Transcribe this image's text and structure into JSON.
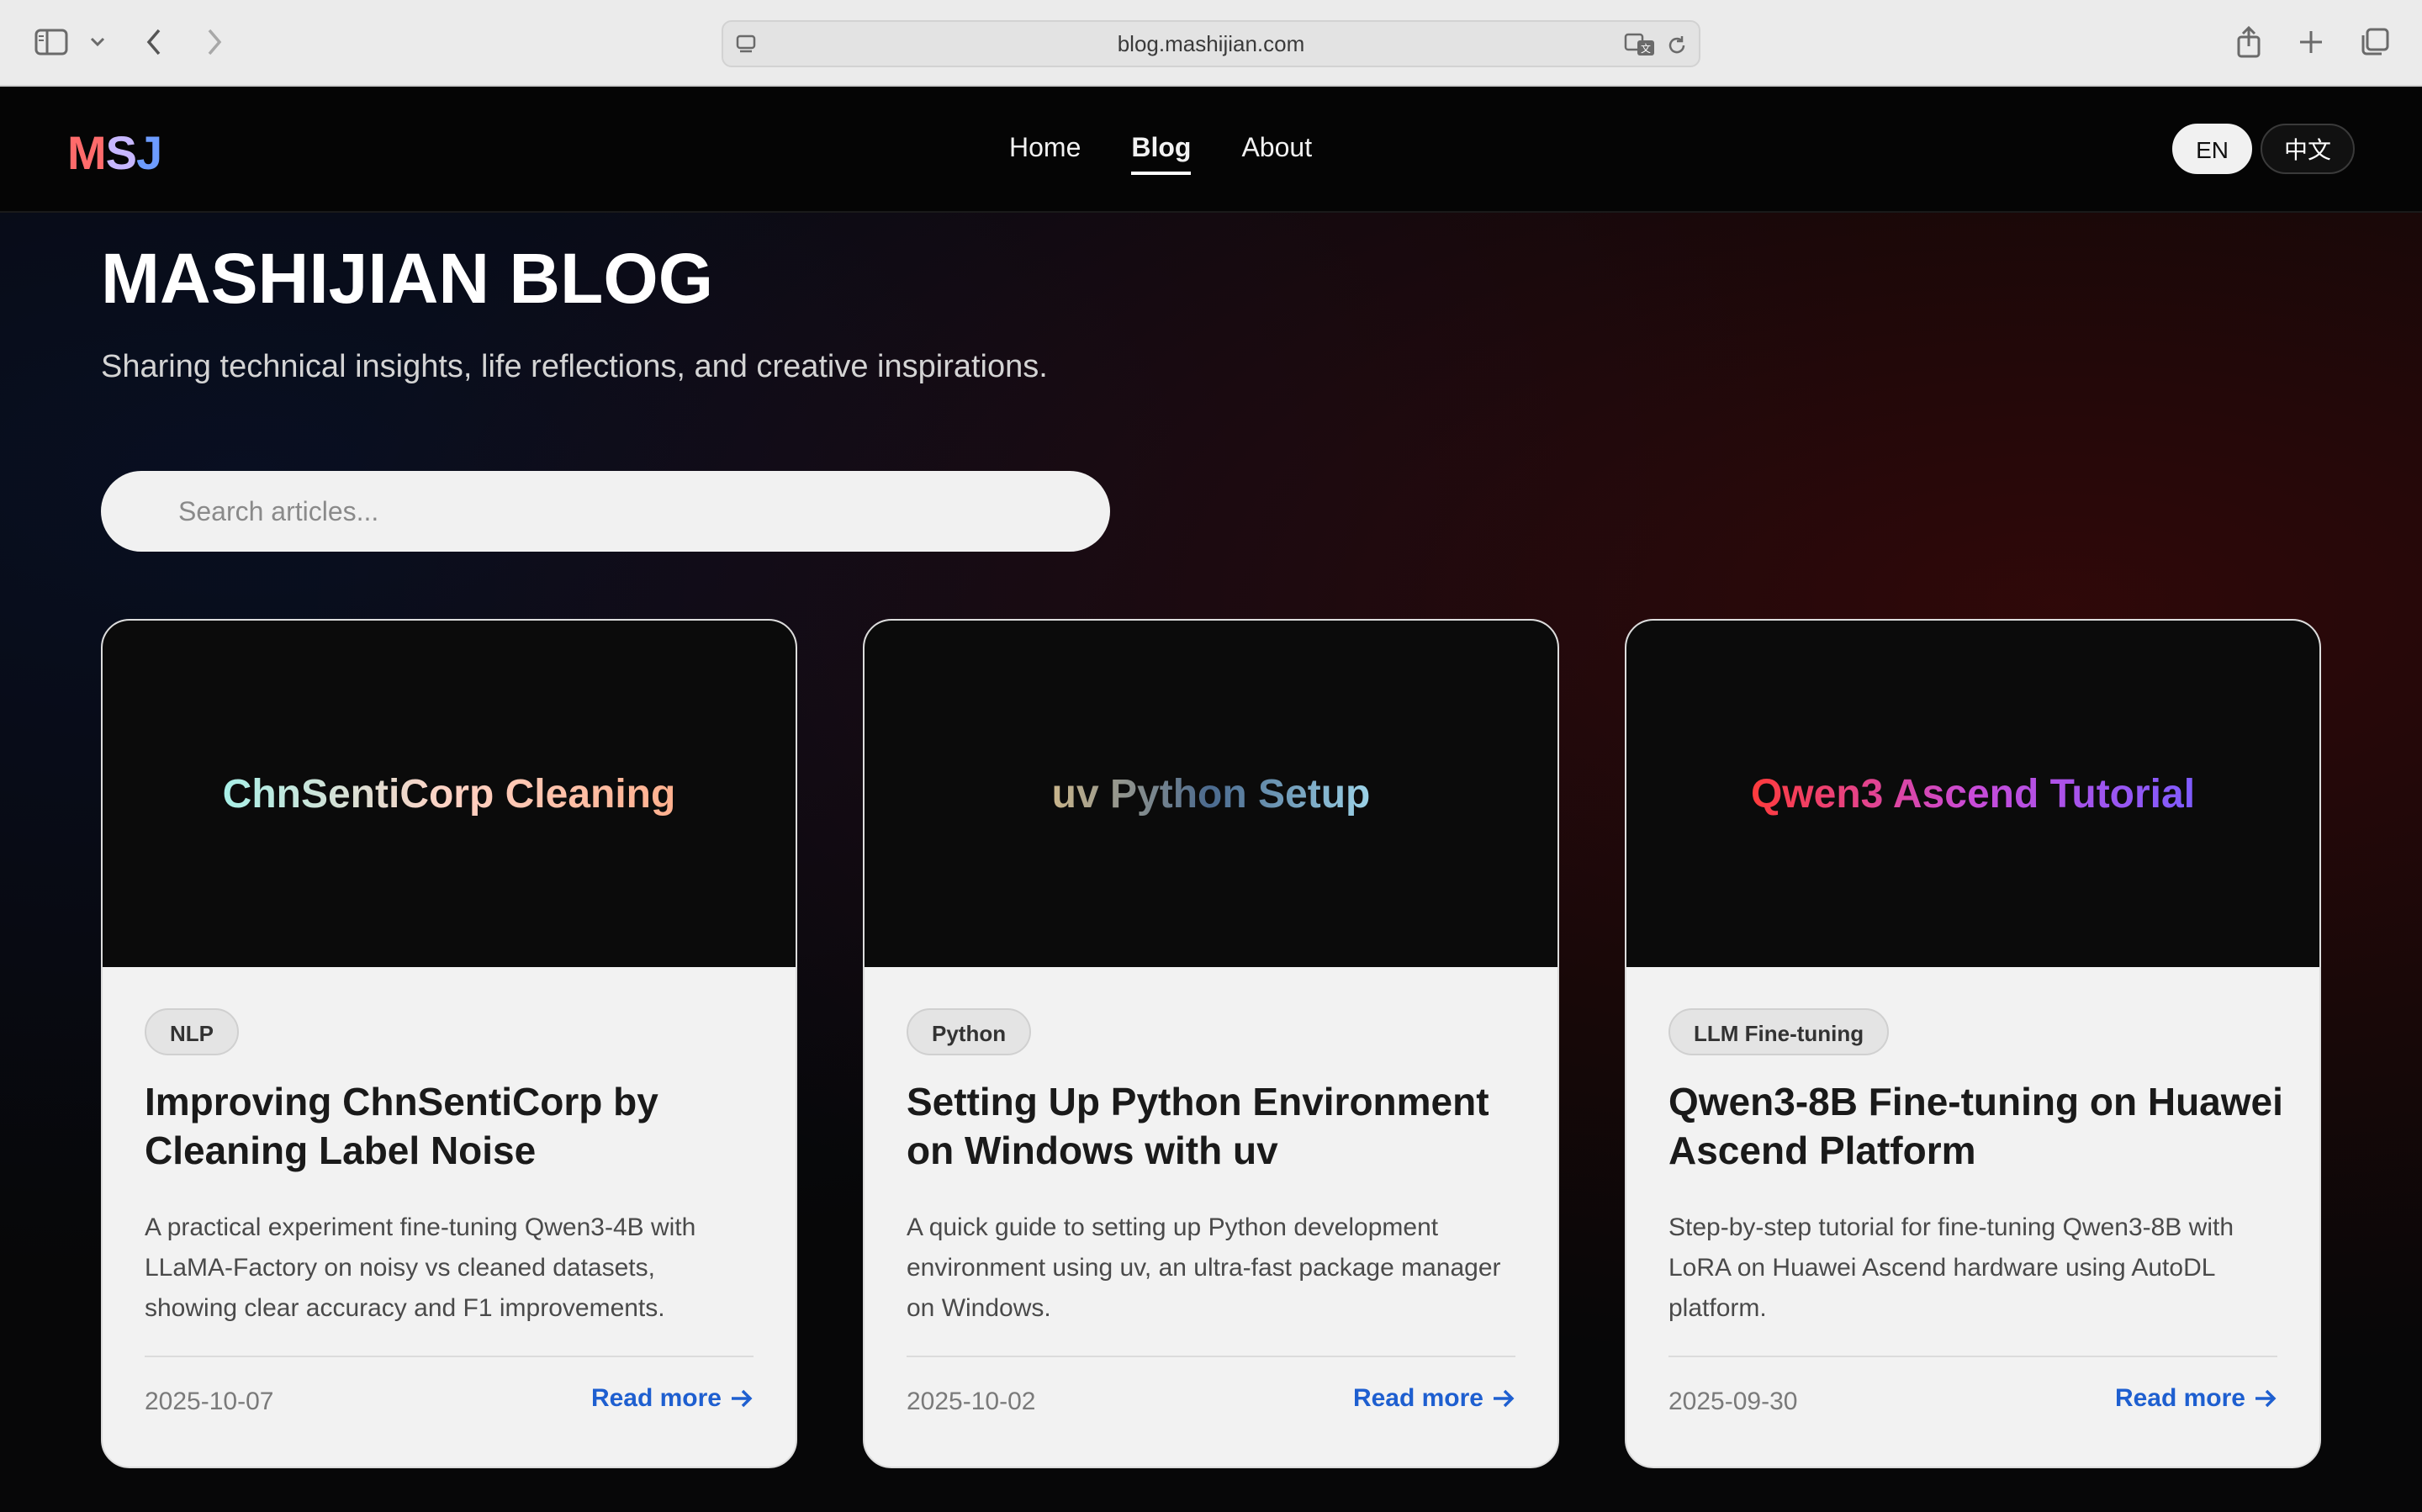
{
  "browser": {
    "url": "blog.mashijian.com"
  },
  "header": {
    "logo": [
      "M",
      "S",
      "J"
    ],
    "nav": [
      {
        "label": "Home"
      },
      {
        "label": "Blog",
        "active": true
      },
      {
        "label": "About"
      }
    ],
    "languages": [
      {
        "label": "EN",
        "active": true
      },
      {
        "label": "中文"
      }
    ]
  },
  "main": {
    "title": "MASHIJIAN BLOG",
    "subtitle": "Sharing technical insights, life reflections, and creative inspirations.",
    "search_placeholder": "Search articles...",
    "posts": [
      {
        "cover_text": "ChnSentiCorp Cleaning",
        "tag": "NLP",
        "title": "Improving ChnSentiCorp by Cleaning Label Noise",
        "excerpt": "A practical experiment fine-tuning Qwen3-4B with LLaMA-Factory on noisy vs cleaned datasets, showing clear accuracy and F1 improvements.",
        "date": "2025-10-07",
        "read_more": "Read more"
      },
      {
        "cover_text": "uv Python Setup",
        "tag": "Python",
        "title": "Setting Up Python Environment on Windows with uv",
        "excerpt": "A quick guide to setting up Python development environment using uv, an ultra-fast package manager on Windows.",
        "date": "2025-10-02",
        "read_more": "Read more"
      },
      {
        "cover_text": "Qwen3 Ascend Tutorial",
        "tag": "LLM Fine-tuning",
        "title": "Qwen3-8B Fine-tuning on Huawei Ascend Platform",
        "excerpt": "Step-by-step tutorial for fine-tuning Qwen3-8B with LoRA on Huawei Ascend hardware using AutoDL platform.",
        "date": "2025-09-30",
        "read_more": "Read more"
      }
    ]
  },
  "colors": {
    "link": "#1e5fd0",
    "page_bg": "#070708",
    "card_bg": "#f2f2f2"
  }
}
